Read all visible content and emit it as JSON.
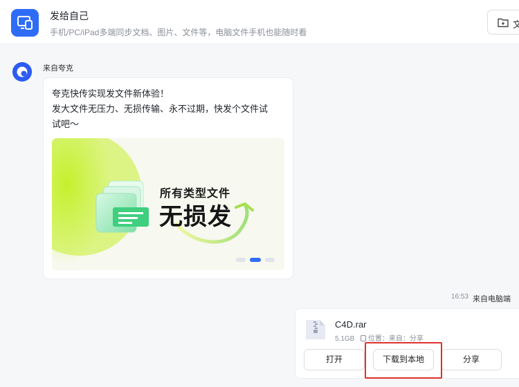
{
  "header": {
    "title": "发给自己",
    "subtitle": "手机/PC/iPad多端同步文档、图片、文件等，电脑文件手机也能随时看",
    "files_button_label": "文"
  },
  "message": {
    "sender": "来自夸克",
    "text_line1": "夸克快传实现发文件新体验！",
    "text_line2": "发大文件无压力、无损传输、永不过期，快发个文件试",
    "text_line3": "试吧～",
    "banner": {
      "title1": "所有类型文件",
      "title2": "无损发"
    }
  },
  "file_message": {
    "time": "16:53",
    "source": "来自电脑端",
    "file_name": "C4D.rar",
    "size": "5.1GB",
    "location": "位置：来自：分享",
    "buttons": {
      "open": "打开",
      "download": "下载到本地",
      "share": "分享"
    }
  },
  "colors": {
    "brand_blue": "#2f6cf6",
    "highlight_red": "#e0302c",
    "banner_green": "#c8f23a"
  }
}
